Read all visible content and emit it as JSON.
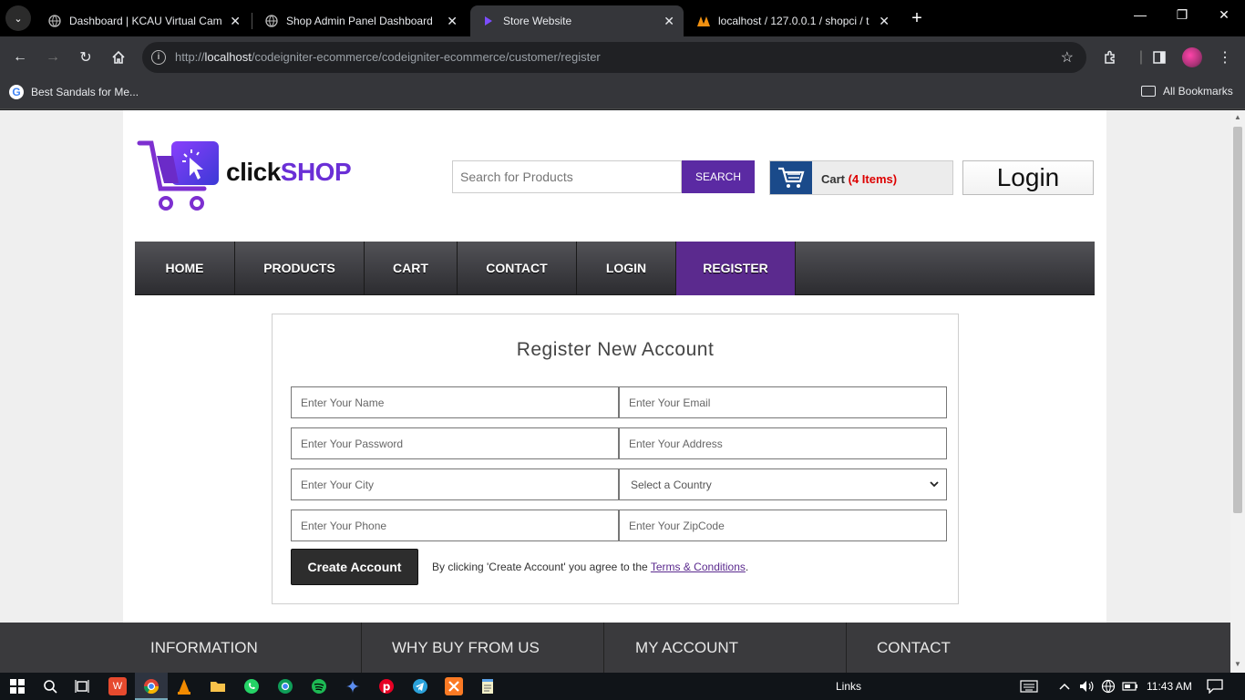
{
  "browser": {
    "tabs": [
      {
        "title": "Dashboard | KCAU Virtual Camp",
        "favicon": "globe-icon",
        "active": false
      },
      {
        "title": "Shop Admin Panel Dashboard",
        "favicon": "globe-icon",
        "active": false
      },
      {
        "title": "Store Website",
        "favicon": "store-icon",
        "active": true
      },
      {
        "title": "localhost / 127.0.0.1 / shopci / t",
        "favicon": "phpmyadmin-icon",
        "active": false
      }
    ],
    "url_scheme": "http://",
    "url_host": "localhost",
    "url_path": "/codeigniter-ecommerce/codeigniter-ecommerce/customer/register",
    "bookmarks": [
      {
        "label": "Best Sandals for Me..."
      }
    ],
    "all_bookmarks_label": "All Bookmarks"
  },
  "store": {
    "logo_text_1": "click",
    "logo_text_2": "SHOP",
    "search_placeholder": "Search for Products",
    "search_button": "SEARCH",
    "cart_label": "Cart",
    "cart_count": "(4 Items)",
    "login_label": "Login",
    "nav": [
      {
        "label": "HOME",
        "active": false
      },
      {
        "label": "PRODUCTS",
        "active": false
      },
      {
        "label": "CART",
        "active": false
      },
      {
        "label": "CONTACT",
        "active": false
      },
      {
        "label": "LOGIN",
        "active": false
      },
      {
        "label": "REGISTER",
        "active": true
      }
    ]
  },
  "register": {
    "title": "Register New Account",
    "name_placeholder": "Enter Your Name",
    "email_placeholder": "Enter Your Email",
    "password_placeholder": "Enter Your Password",
    "address_placeholder": "Enter Your Address",
    "city_placeholder": "Enter Your City",
    "country_selected": "Select a Country",
    "phone_placeholder": "Enter Your Phone",
    "zip_placeholder": "Enter Your ZipCode",
    "create_button": "Create Account",
    "terms_prefix": "By clicking 'Create Account' you agree to the",
    "terms_link": "Terms & Conditions",
    "terms_suffix": "."
  },
  "footer": {
    "columns": [
      "INFORMATION",
      "WHY BUY FROM US",
      "MY ACCOUNT",
      "CONTACT"
    ]
  },
  "taskbar": {
    "links_label": "Links",
    "time": "11:43 AM"
  },
  "colors": {
    "brand_purple": "#5b2aa3",
    "nav_active": "#5b2a8e",
    "cart_blue": "#1a4a8a",
    "cart_count_red": "#dd0000"
  }
}
